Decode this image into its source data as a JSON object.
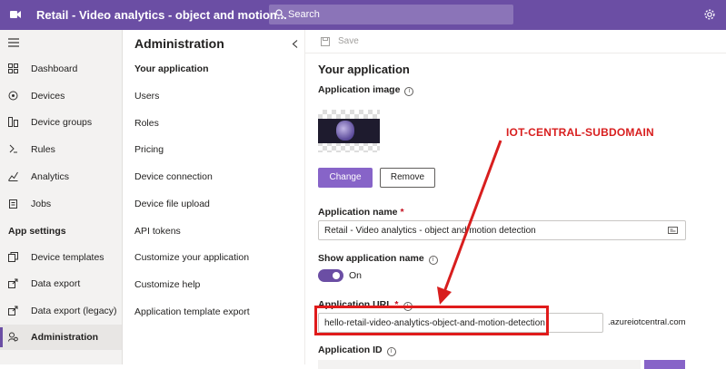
{
  "topbar": {
    "title": "Retail - Video analytics - object and motion...",
    "search_placeholder": "Search",
    "bg_color": "#6b4ea4"
  },
  "leftnav": {
    "items": [
      {
        "label": "Dashboard",
        "icon": "dashboard-icon"
      },
      {
        "label": "Devices",
        "icon": "devices-icon"
      },
      {
        "label": "Device groups",
        "icon": "device-groups-icon"
      },
      {
        "label": "Rules",
        "icon": "rules-icon"
      },
      {
        "label": "Analytics",
        "icon": "analytics-icon"
      },
      {
        "label": "Jobs",
        "icon": "jobs-icon"
      }
    ],
    "section_heading": "App settings",
    "settings_items": [
      {
        "label": "Device templates",
        "icon": "device-templates-icon"
      },
      {
        "label": "Data export",
        "icon": "data-export-icon"
      },
      {
        "label": "Data export (legacy)",
        "icon": "data-export-legacy-icon"
      },
      {
        "label": "Administration",
        "icon": "administration-icon",
        "active": true
      }
    ]
  },
  "subnav": {
    "header": "Administration",
    "items": [
      {
        "label": "Your application",
        "active": true
      },
      {
        "label": "Users"
      },
      {
        "label": "Roles"
      },
      {
        "label": "Pricing"
      },
      {
        "label": "Device connection"
      },
      {
        "label": "Device file upload"
      },
      {
        "label": "API tokens"
      },
      {
        "label": "Customize your application"
      },
      {
        "label": "Customize help"
      },
      {
        "label": "Application template export"
      }
    ]
  },
  "main": {
    "save_label": "Save",
    "title": "Your application",
    "app_image_label": "Application image",
    "change_button": "Change",
    "remove_button": "Remove",
    "app_name_label": "Application name",
    "app_name_value": "Retail - Video analytics - object and motion detection",
    "show_name_label": "Show application name",
    "toggle_state": "On",
    "app_url_label": "Application URL",
    "app_url_value": "hello-retail-video-analytics-object-and-motion-detection",
    "app_url_suffix": ".azureiotcentral.com",
    "app_id_label": "Application ID",
    "required_mark": "*"
  },
  "annotation": {
    "text": "IOT-CENTRAL-SUBDOMAIN",
    "color": "#d81e1e"
  }
}
